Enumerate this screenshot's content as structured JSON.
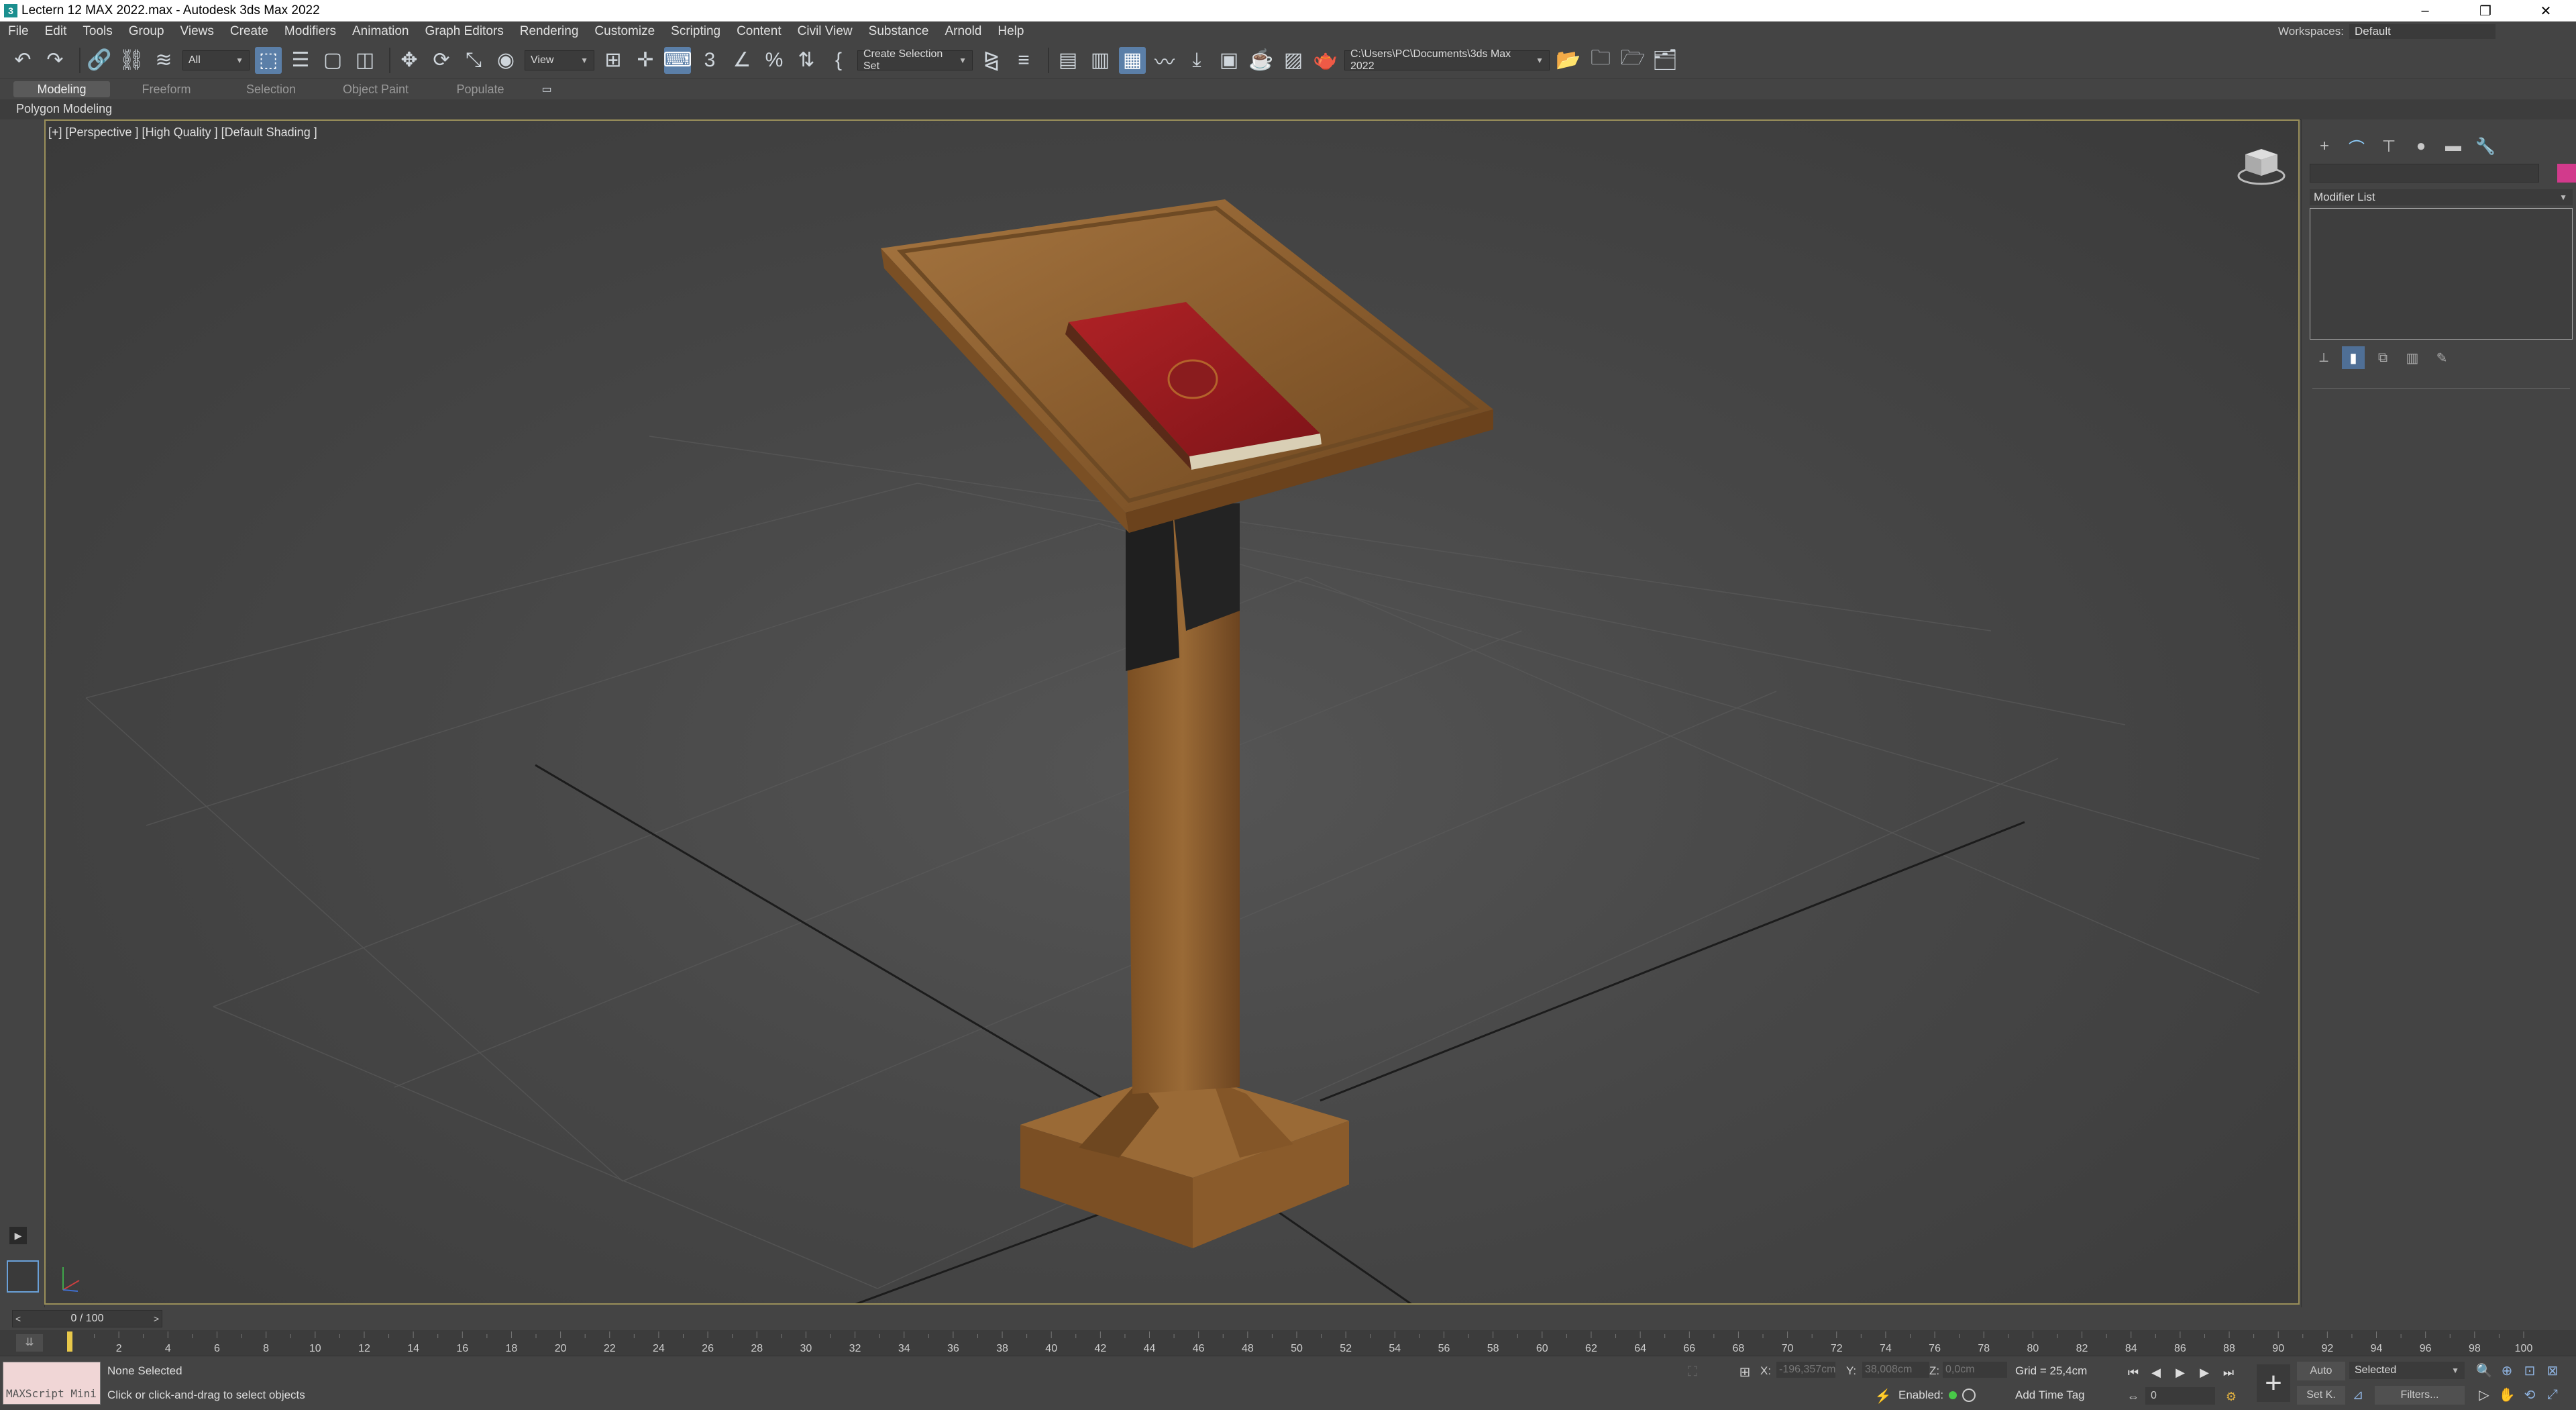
{
  "window": {
    "title": "Lectern 12 MAX 2022.max - Autodesk 3ds Max 2022",
    "controls": [
      "–",
      "❐",
      "✕"
    ]
  },
  "menu": {
    "items": [
      "File",
      "Edit",
      "Tools",
      "Group",
      "Views",
      "Create",
      "Modifiers",
      "Animation",
      "Graph Editors",
      "Rendering",
      "Customize",
      "Scripting",
      "Content",
      "Civil View",
      "Substance",
      "Arnold",
      "Help"
    ],
    "workspaces_label": "Workspaces:",
    "workspaces_value": "Default"
  },
  "toolbar": {
    "filter_value": "All",
    "ref_coord_value": "View",
    "selection_set_placeholder": "Create Selection Set",
    "project_path": "C:\\Users\\PC\\Documents\\3ds Max 2022"
  },
  "ribbon": {
    "tabs": [
      "Modeling",
      "Freeform",
      "Selection",
      "Object Paint",
      "Populate"
    ],
    "active_tab": "Modeling",
    "panel_label": "Polygon Modeling"
  },
  "viewport": {
    "label": "[+] [Perspective ] [High Quality ] [Default Shading ]"
  },
  "command_panel": {
    "modifier_list_label": "Modifier List",
    "object_color": "#d23a8c"
  },
  "timeline": {
    "slider_label": "0 / 100",
    "prev": "<",
    "next": ">",
    "ticks": [
      "0",
      "2",
      "4",
      "6",
      "8",
      "10",
      "12",
      "14",
      "16",
      "18",
      "20",
      "22",
      "24",
      "26",
      "28",
      "30",
      "32",
      "34",
      "36",
      "38",
      "40",
      "42",
      "44",
      "46",
      "48",
      "50",
      "52",
      "54",
      "56",
      "58",
      "60",
      "62",
      "64",
      "66",
      "68",
      "70",
      "72",
      "74",
      "76",
      "78",
      "80",
      "82",
      "84",
      "86",
      "88",
      "90",
      "92",
      "94",
      "96",
      "98",
      "100"
    ]
  },
  "status": {
    "maxscript_label": "MAXScript Mini",
    "selection": "None Selected",
    "prompt": "Click or click-and-drag to select objects",
    "x_label": "X:",
    "x_value": "-196,357cm",
    "y_label": "Y:",
    "y_value": "38,008cm",
    "z_label": "Z:",
    "z_value": "0,0cm",
    "grid": "Grid = 25,4cm",
    "enabled_label": "Enabled:",
    "add_time_tag": "Add Time Tag",
    "auto_label": "Auto",
    "set_key_label": "Set K.",
    "key_filter_value": "Selected",
    "filters_label": "Filters...",
    "current_frame": "0"
  }
}
